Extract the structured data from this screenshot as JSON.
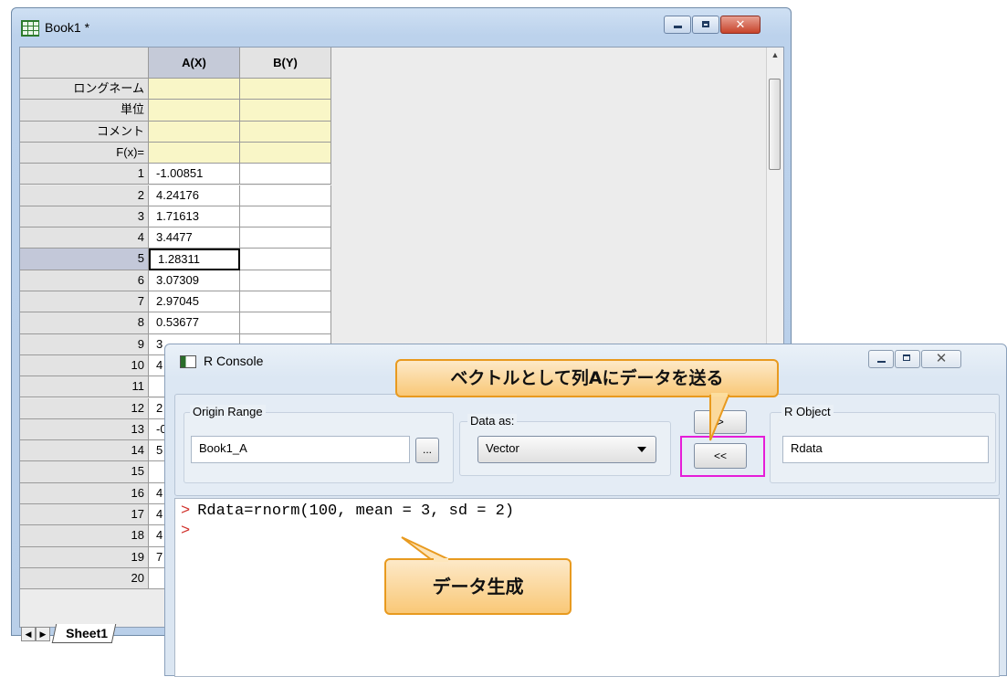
{
  "book": {
    "title": "Book1 *",
    "columns": [
      "A(X)",
      "B(Y)"
    ],
    "meta_rows": [
      "ロングネーム",
      "単位",
      "コメント",
      "F(x)="
    ],
    "rows": [
      {
        "n": "1",
        "a": "-1.00851",
        "b": ""
      },
      {
        "n": "2",
        "a": "4.24176",
        "b": ""
      },
      {
        "n": "3",
        "a": "1.71613",
        "b": ""
      },
      {
        "n": "4",
        "a": "3.4477",
        "b": ""
      },
      {
        "n": "5",
        "a": "1.28311",
        "b": ""
      },
      {
        "n": "6",
        "a": "3.07309",
        "b": ""
      },
      {
        "n": "7",
        "a": "2.97045",
        "b": ""
      },
      {
        "n": "8",
        "a": "0.53677",
        "b": ""
      },
      {
        "n": "9",
        "a": "3",
        "b": ""
      },
      {
        "n": "10",
        "a": "4",
        "b": ""
      },
      {
        "n": "11",
        "a": "",
        "b": ""
      },
      {
        "n": "12",
        "a": "2",
        "b": ""
      },
      {
        "n": "13",
        "a": "-0",
        "b": ""
      },
      {
        "n": "14",
        "a": "5",
        "b": ""
      },
      {
        "n": "15",
        "a": "",
        "b": ""
      },
      {
        "n": "16",
        "a": "4",
        "b": ""
      },
      {
        "n": "17",
        "a": "4",
        "b": ""
      },
      {
        "n": "18",
        "a": "4",
        "b": ""
      },
      {
        "n": "19",
        "a": "7",
        "b": ""
      },
      {
        "n": "20",
        "a": "",
        "b": ""
      }
    ],
    "selected_row": "5",
    "sheet_tab": "Sheet1"
  },
  "rconsole": {
    "title": "R Console",
    "origin_range_label": "Origin Range",
    "origin_range_value": "Book1_A",
    "browse_label": "...",
    "data_as_label": "Data as:",
    "data_as_value": "Vector",
    "send_to_r_label": ">",
    "send_to_origin_label": "<<",
    "r_object_label": "R Object",
    "r_object_value": "Rdata",
    "console_lines": [
      "Rdata=rnorm(100, mean = 3, sd = 2)",
      ""
    ],
    "prompt_symbol": ">"
  },
  "callouts": {
    "send_vector": "ベクトルとして列Aにデータを送る",
    "generate": "データ生成"
  },
  "colors": {
    "highlight": "#e51dd8",
    "callout_border": "#e89a1f",
    "prompt": "#d0302a"
  }
}
